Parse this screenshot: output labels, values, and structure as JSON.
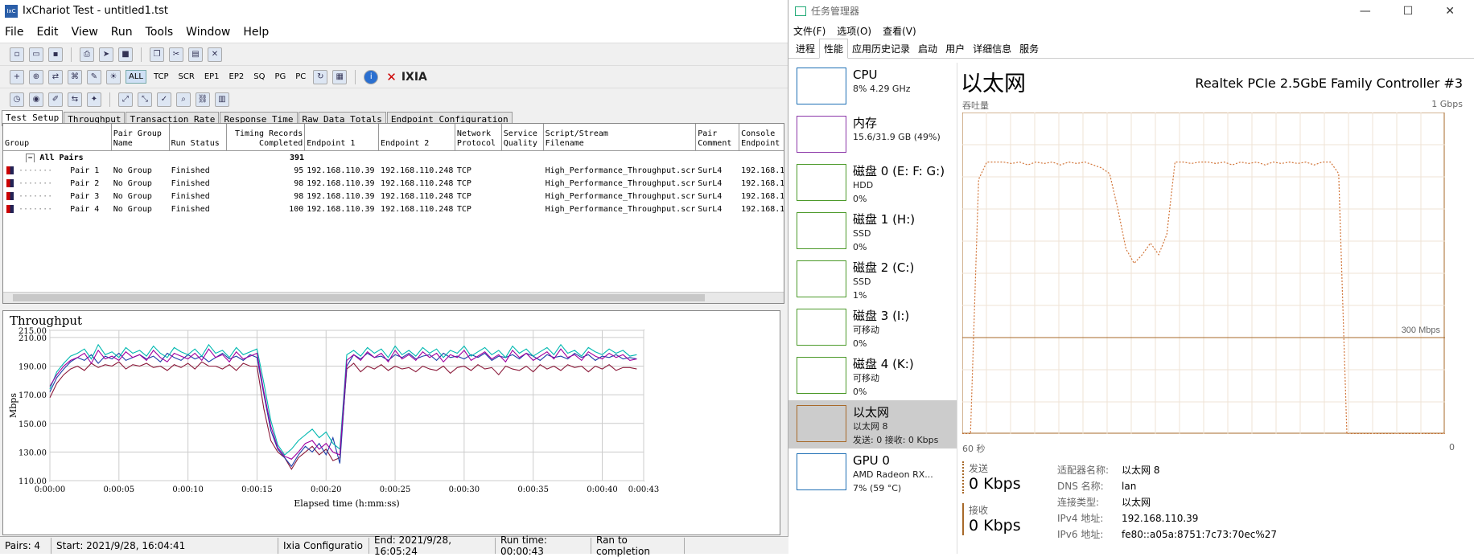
{
  "ix": {
    "title": "IxChariot Test - untitled1.tst",
    "menu": [
      "File",
      "Edit",
      "View",
      "Run",
      "Tools",
      "Window",
      "Help"
    ],
    "toolbar2_labels": [
      "ALL",
      "TCP",
      "SCR",
      "EP1",
      "EP2",
      "SQ",
      "PG",
      "PC"
    ],
    "brand": "IXIA",
    "tabs": [
      "Test Setup",
      "Throughput",
      "Transaction Rate",
      "Response Time",
      "Raw Data Totals",
      "Endpoint Configuration"
    ],
    "columns": [
      "Group",
      "Pair Group\nName",
      "Run Status",
      "Timing Records\nCompleted",
      "Endpoint 1",
      "Endpoint 2",
      "Network\nProtocol",
      "Service\nQuality",
      "Script/Stream\nFilename",
      "Pair\nComment",
      "Console\nEndpoint"
    ],
    "all_pairs": {
      "label": "All Pairs",
      "records": "391",
      "toggle": "−"
    },
    "rows": [
      {
        "name": "Pair 1",
        "group": "No Group",
        "status": "Finished",
        "records": "95",
        "ep1": "192.168.110.39",
        "ep2": "192.168.110.248",
        "proto": "TCP",
        "script": "High_Performance_Throughput.scr",
        "comment": "SurL4",
        "console": "192.168.1"
      },
      {
        "name": "Pair 2",
        "group": "No Group",
        "status": "Finished",
        "records": "98",
        "ep1": "192.168.110.39",
        "ep2": "192.168.110.248",
        "proto": "TCP",
        "script": "High_Performance_Throughput.scr",
        "comment": "SurL4",
        "console": "192.168.1"
      },
      {
        "name": "Pair 3",
        "group": "No Group",
        "status": "Finished",
        "records": "98",
        "ep1": "192.168.110.39",
        "ep2": "192.168.110.248",
        "proto": "TCP",
        "script": "High_Performance_Throughput.scr",
        "comment": "SurL4",
        "console": "192.168.1"
      },
      {
        "name": "Pair 4",
        "group": "No Group",
        "status": "Finished",
        "records": "100",
        "ep1": "192.168.110.39",
        "ep2": "192.168.110.248",
        "proto": "TCP",
        "script": "High_Performance_Throughput.scr",
        "comment": "SurL4",
        "console": "192.168.1"
      }
    ],
    "status": {
      "pairs": "Pairs: 4",
      "start": "Start: 2021/9/28, 16:04:41",
      "config": "Ixia Configuratio",
      "end": "End: 2021/9/28, 16:05:24",
      "run": "Run time: 00:00:43",
      "result": "Ran to completion"
    }
  },
  "chart_data": {
    "type": "line",
    "title": "Throughput",
    "xlabel": "Elapsed time (h:mm:ss)",
    "ylabel": "Mbps",
    "ylim": [
      110,
      215
    ],
    "yticks": [
      "215.00",
      "210.00",
      "190.00",
      "170.00",
      "150.00",
      "130.00",
      "110.00"
    ],
    "xlim": [
      0,
      43
    ],
    "xticks": [
      "0:00:00",
      "0:00:05",
      "0:00:10",
      "0:00:15",
      "0:00:20",
      "0:00:25",
      "0:00:30",
      "0:00:35",
      "0:00:40",
      "0:00:43"
    ],
    "grid": true,
    "x": [
      0,
      0.5,
      1,
      1.5,
      2,
      2.5,
      3,
      3.5,
      4,
      4.5,
      5,
      5.5,
      6,
      6.5,
      7,
      7.5,
      8,
      8.5,
      9,
      9.5,
      10,
      10.5,
      11,
      11.5,
      12,
      12.5,
      13,
      13.5,
      14,
      14.5,
      15,
      15.5,
      16,
      16.5,
      17,
      17.5,
      18,
      18.5,
      19,
      19.5,
      20,
      20.5,
      21,
      21.5,
      22,
      22.5,
      23,
      23.5,
      24,
      24.5,
      25,
      25.5,
      26,
      26.5,
      27,
      27.5,
      28,
      28.5,
      29,
      29.5,
      30,
      30.5,
      31,
      31.5,
      32,
      32.5,
      33,
      33.5,
      34,
      34.5,
      35,
      35.5,
      36,
      36.5,
      37,
      37.5,
      38,
      38.5,
      39,
      39.5,
      40,
      40.5,
      41,
      41.5,
      42,
      42.5
    ],
    "series": [
      {
        "color": "#8b1a3a",
        "values": [
          168,
          178,
          184,
          188,
          190,
          187,
          192,
          189,
          191,
          190,
          193,
          188,
          191,
          190,
          192,
          189,
          190,
          187,
          191,
          189,
          192,
          188,
          193,
          190,
          190,
          188,
          191,
          187,
          192,
          190,
          190,
          160,
          138,
          130,
          126,
          118,
          126,
          130,
          134,
          128,
          132,
          124,
          126,
          188,
          192,
          186,
          190,
          188,
          191,
          187,
          190,
          188,
          189,
          186,
          190,
          188,
          187,
          190,
          185,
          189,
          190,
          187,
          191,
          188,
          189,
          184,
          190,
          188,
          187,
          190,
          186,
          191,
          188,
          190,
          187,
          191,
          189,
          190,
          186,
          190,
          188,
          191,
          187,
          189,
          189,
          188
        ]
      },
      {
        "color": "#1d3fa8",
        "values": [
          172,
          182,
          188,
          193,
          196,
          194,
          198,
          192,
          197,
          195,
          199,
          194,
          196,
          198,
          195,
          197,
          193,
          199,
          196,
          194,
          198,
          195,
          197,
          193,
          196,
          199,
          195,
          197,
          194,
          198,
          196,
          170,
          145,
          132,
          126,
          120,
          128,
          134,
          130,
          136,
          128,
          140,
          122,
          190,
          198,
          195,
          199,
          196,
          197,
          194,
          198,
          196,
          199,
          195,
          197,
          198,
          194,
          199,
          196,
          197,
          195,
          198,
          196,
          199,
          194,
          197,
          196,
          198,
          195,
          199,
          197,
          194,
          198,
          196,
          197,
          195,
          199,
          196,
          198,
          194,
          197,
          196,
          198,
          195,
          196,
          195
        ]
      },
      {
        "color": "#00b8b0",
        "values": [
          174,
          186,
          192,
          197,
          199,
          202,
          195,
          205,
          198,
          200,
          196,
          203,
          199,
          201,
          197,
          204,
          199,
          196,
          203,
          200,
          198,
          202,
          197,
          205,
          199,
          201,
          196,
          203,
          198,
          200,
          202,
          178,
          152,
          135,
          128,
          132,
          138,
          142,
          146,
          140,
          144,
          136,
          132,
          198,
          201,
          197,
          203,
          199,
          202,
          196,
          204,
          198,
          201,
          197,
          203,
          199,
          202,
          196,
          201,
          199,
          204,
          197,
          200,
          203,
          198,
          201,
          196,
          204,
          199,
          202,
          197,
          200,
          203,
          198,
          205,
          199,
          201,
          197,
          203,
          200,
          198,
          202,
          199,
          201,
          197,
          198
        ]
      },
      {
        "color": "#a000a0",
        "values": [
          176,
          184,
          190,
          194,
          196,
          199,
          192,
          201,
          195,
          197,
          194,
          200,
          196,
          198,
          194,
          201,
          196,
          193,
          199,
          197,
          195,
          199,
          194,
          202,
          196,
          198,
          193,
          200,
          195,
          197,
          199,
          172,
          148,
          133,
          127,
          125,
          130,
          136,
          138,
          132,
          136,
          130,
          128,
          194,
          198,
          194,
          200,
          196,
          199,
          193,
          201,
          195,
          198,
          194,
          200,
          196,
          199,
          193,
          198,
          196,
          201,
          194,
          197,
          200,
          195,
          198,
          193,
          201,
          196,
          199,
          194,
          197,
          200,
          195,
          202,
          196,
          198,
          194,
          200,
          197,
          195,
          199,
          196,
          198,
          194,
          195
        ]
      }
    ]
  },
  "tm": {
    "title": "任务管理器",
    "menu": [
      "文件(F)",
      "选项(O)",
      "查看(V)"
    ],
    "tabs": [
      "进程",
      "性能",
      "应用历史记录",
      "启动",
      "用户",
      "详细信息",
      "服务"
    ],
    "side": [
      {
        "name": "CPU",
        "l1": "8% 4.29 GHz",
        "l2": "",
        "color": "#1e6fb5"
      },
      {
        "name": "内存",
        "l1": "15.6/31.9 GB (49%)",
        "l2": "",
        "color": "#8b36a8"
      },
      {
        "name": "磁盘 0 (E: F: G:)",
        "l1": "HDD",
        "l2": "0%",
        "color": "#4c9a2a"
      },
      {
        "name": "磁盘 1 (H:)",
        "l1": "SSD",
        "l2": "0%",
        "color": "#4c9a2a"
      },
      {
        "name": "磁盘 2 (C:)",
        "l1": "SSD",
        "l2": "1%",
        "color": "#4c9a2a"
      },
      {
        "name": "磁盘 3 (I:)",
        "l1": "可移动",
        "l2": "0%",
        "color": "#4c9a2a"
      },
      {
        "name": "磁盘 4 (K:)",
        "l1": "可移动",
        "l2": "0%",
        "color": "#4c9a2a"
      },
      {
        "name": "以太网",
        "l1": "以太网 8",
        "l2": "发送: 0 接收: 0 Kbps",
        "color": "#a7692a"
      },
      {
        "name": "GPU 0",
        "l1": "AMD Radeon RX...",
        "l2": "7% (59 °C)",
        "color": "#1e6fb5"
      }
    ],
    "heading": "以太网",
    "adapter": "Realtek PCIe 2.5GbE Family Controller #3",
    "throughput_label": "吞吐量",
    "max_label": "1 Gbps",
    "mid_label": "300 Mbps",
    "x_left": "60 秒",
    "x_right": "0",
    "send_label": "发送",
    "send_val": "0 Kbps",
    "recv_label": "接收",
    "recv_val": "0 Kbps",
    "info": [
      [
        "适配器名称:",
        "以太网 8"
      ],
      [
        "DNS 名称:",
        "lan"
      ],
      [
        "连接类型:",
        "以太网"
      ],
      [
        "IPv4 地址:",
        "192.168.110.39"
      ],
      [
        "IPv6 地址:",
        "fe80::a05a:8751:7c73:70ec%27"
      ]
    ],
    "graph": {
      "range_mbps": [
        0,
        1000
      ],
      "ref_mbps": 300,
      "seconds": [
        60,
        0
      ],
      "mbps": [
        0,
        0,
        880,
        940,
        940,
        940,
        935,
        940,
        930,
        940,
        935,
        940,
        930,
        940,
        935,
        940,
        930,
        920,
        900,
        780,
        640,
        590,
        620,
        660,
        620,
        690,
        940,
        940,
        935,
        940,
        940,
        935,
        940,
        930,
        940,
        935,
        940,
        930,
        940,
        935,
        940,
        935,
        940,
        930,
        940,
        940,
        900,
        0,
        0,
        0,
        0,
        0,
        0,
        0,
        0,
        0,
        0,
        0,
        0,
        0
      ]
    }
  }
}
